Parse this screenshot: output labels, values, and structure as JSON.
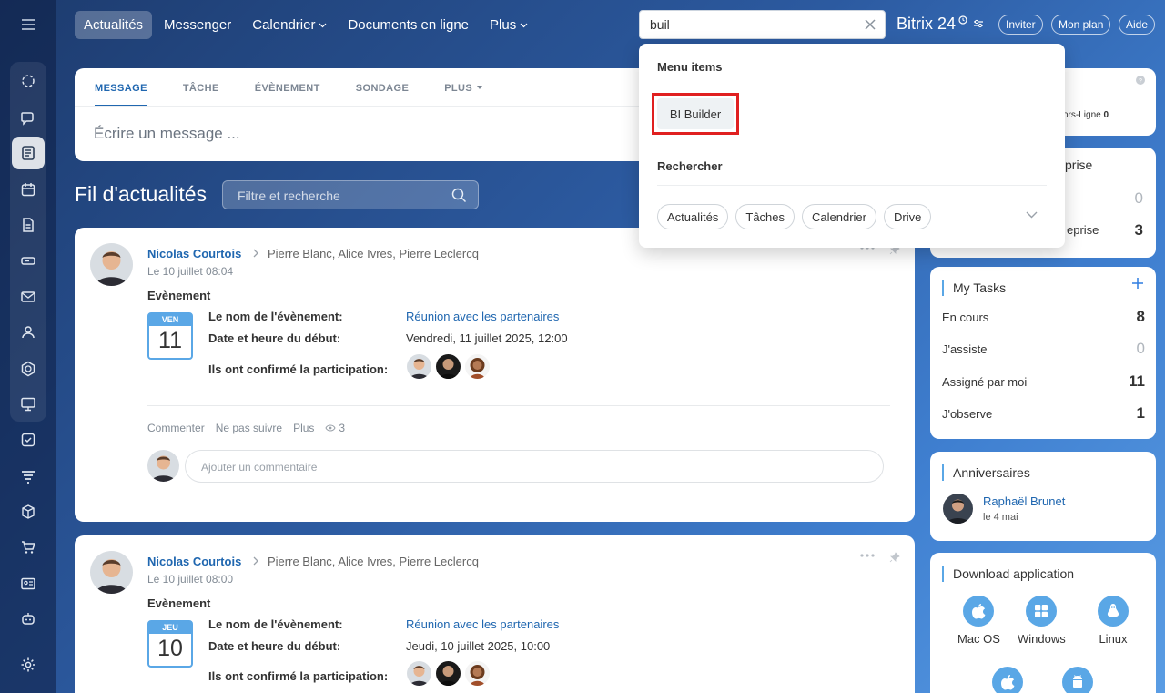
{
  "topnav": {
    "items": [
      {
        "label": "Actualités"
      },
      {
        "label": "Messenger"
      },
      {
        "label": "Calendrier"
      },
      {
        "label": "Documents en ligne"
      },
      {
        "label": "Plus"
      }
    ]
  },
  "search": {
    "value": "buil"
  },
  "brand": {
    "name": "Bitrix 24"
  },
  "header_buttons": {
    "invite": "Inviter",
    "plan": "Mon plan",
    "help": "Aide"
  },
  "composer": {
    "tabs": [
      "MESSAGE",
      "TÂCHE",
      "ÉVÈNEMENT",
      "SONDAGE",
      "PLUS"
    ],
    "placeholder": "Écrire un message ..."
  },
  "feed": {
    "title": "Fil d'actualités",
    "filter_placeholder": "Filtre et recherche"
  },
  "posts": [
    {
      "author": "Nicolas Courtois",
      "recipients": "Pierre Blanc, Alice Ivres, Pierre Leclercq",
      "date": "Le 10 juillet 08:04",
      "type": "Evènement",
      "cal_day": "VEN",
      "cal_num": "11",
      "labels": {
        "name": "Le nom de l'évènement:",
        "start": "Date et heure du début:",
        "confirmed": "Ils ont confirmé la participation:"
      },
      "event_name": "Réunion avec les partenaires",
      "event_start": "Vendredi, 11 juillet 2025, 12:00",
      "actions": {
        "comment": "Commenter",
        "unfollow": "Ne pas suivre",
        "more": "Plus",
        "views": "3"
      },
      "comment_placeholder": "Ajouter un commentaire"
    },
    {
      "author": "Nicolas Courtois",
      "recipients": "Pierre Blanc, Alice Ivres, Pierre Leclercq",
      "date": "Le 10 juillet 08:00",
      "type": "Evènement",
      "cal_day": "JEU",
      "cal_num": "10",
      "labels": {
        "name": "Le nom de l'évènement:",
        "start": "Date et heure du début:",
        "confirmed": "Ils ont confirmé la participation:"
      },
      "event_name": "Réunion avec les partenaires",
      "event_start": "Jeudi, 10 juillet 2025, 10:00"
    }
  ],
  "dropdown": {
    "menu_heading": "Menu items",
    "menu_item": "BI Builder",
    "search_heading": "Rechercher",
    "chips": [
      "Actualités",
      "Tâches",
      "Calendrier",
      "Drive"
    ]
  },
  "right": {
    "online_card": {
      "partial_label": "ors-Ligne",
      "partial_value": "0"
    },
    "company_card": {
      "partial_title": "prise",
      "partial_row": "eprise",
      "value_a": "0",
      "value_b": "3"
    },
    "tasks": {
      "title": "My Tasks",
      "rows": [
        {
          "label": "En cours",
          "value": "8"
        },
        {
          "label": "J'assiste",
          "value": "0"
        },
        {
          "label": "Assigné par moi",
          "value": "11"
        },
        {
          "label": "J'observe",
          "value": "1"
        }
      ]
    },
    "birthdays": {
      "title": "Anniversaires",
      "name": "Raphaël Brunet",
      "date": "le 4 mai"
    },
    "download": {
      "title": "Download application",
      "apps": [
        "Mac OS",
        "Windows",
        "Linux"
      ]
    }
  },
  "colors": {
    "accent": "#2067b0",
    "highlight_border": "#e02020",
    "calendar": "#5aa7e6"
  }
}
